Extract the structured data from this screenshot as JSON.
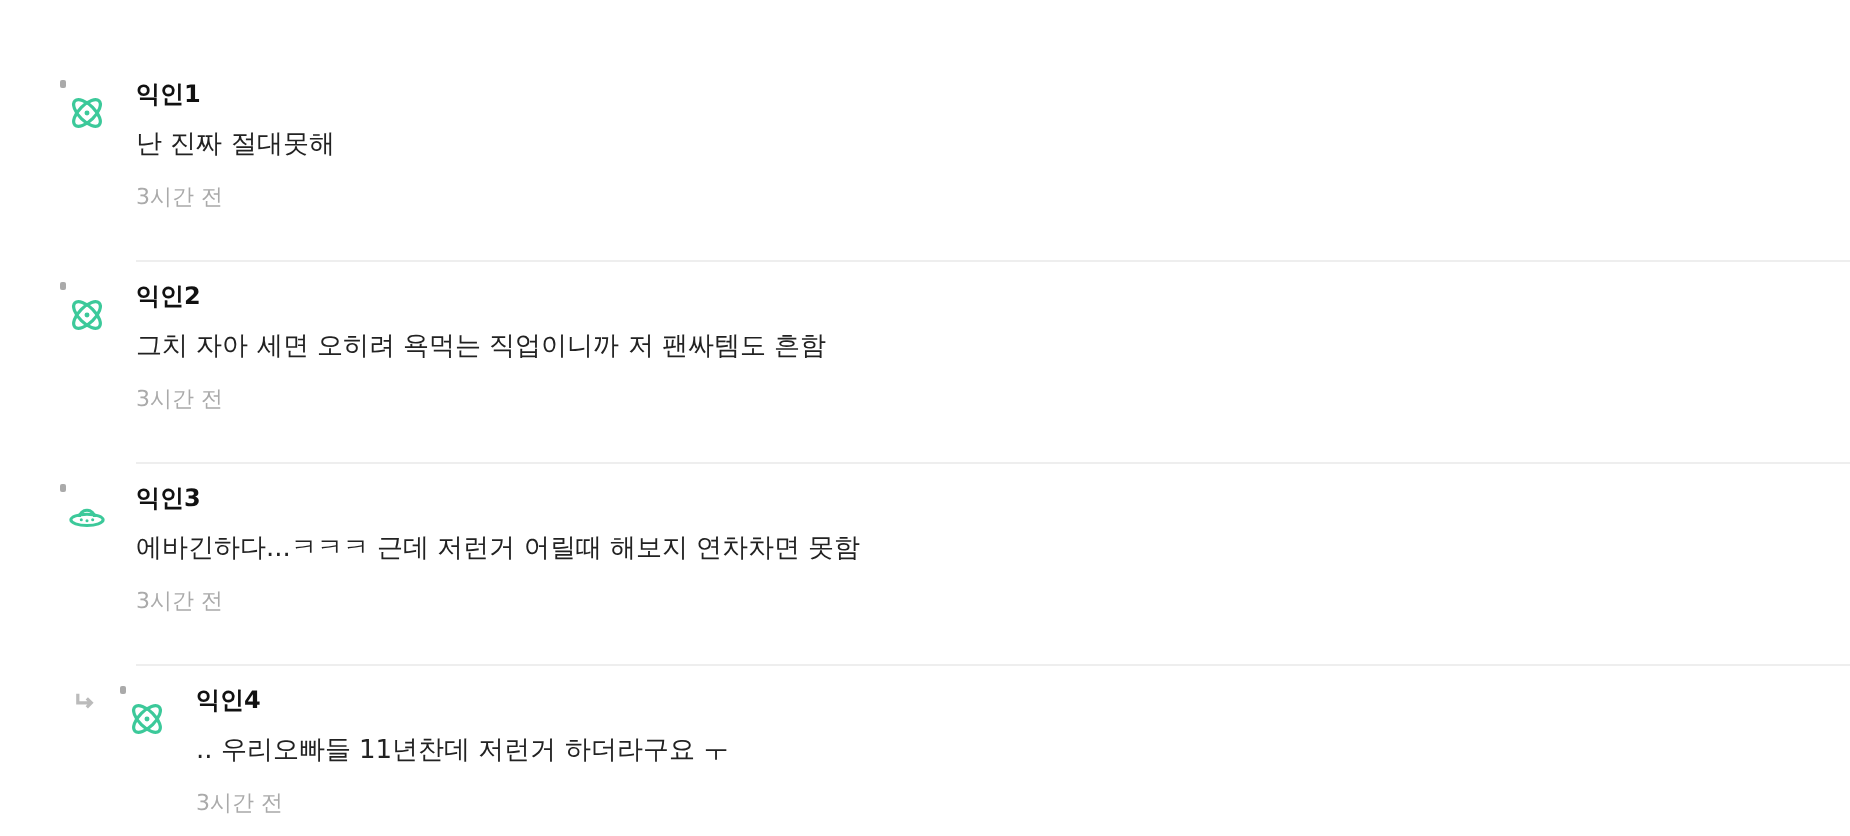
{
  "comments": [
    {
      "author": "익인1",
      "text": "난 진짜 절대못해",
      "time": "3시간 전",
      "reply": false,
      "avatar": {
        "kind": "atom"
      }
    },
    {
      "author": "익인2",
      "text": "그치 자아 세면 오히려 욕먹는 직업이니까 저 팬싸템도 흔함",
      "time": "3시간 전",
      "reply": false,
      "avatar": {
        "kind": "atom"
      }
    },
    {
      "author": "익인3",
      "text": "에바긴하다...ㅋㅋㅋ 근데 저런거 어릴때 해보지 연차차면 못함",
      "time": "3시간 전",
      "reply": false,
      "avatar": {
        "kind": "ufo"
      }
    },
    {
      "author": "익인4",
      "text": ".. 우리오빠들 11년찬데 저런거 하더라구요 ㅜ",
      "time": "3시간 전",
      "reply": true,
      "avatar": {
        "kind": "atom"
      }
    }
  ]
}
